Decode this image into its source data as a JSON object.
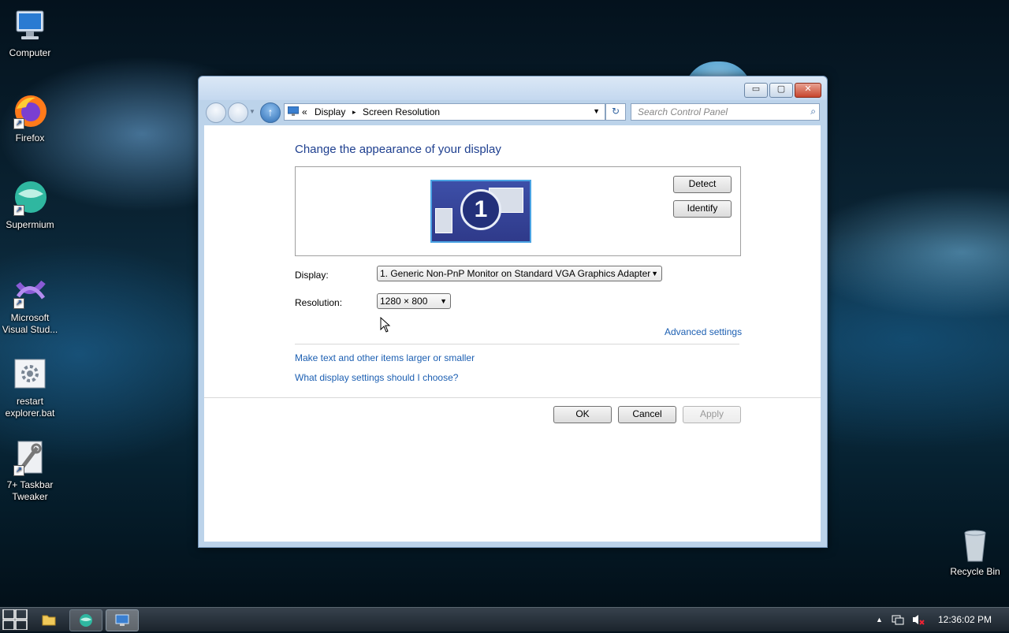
{
  "desktop": {
    "icons": [
      {
        "label": "Computer",
        "icon": "computer-icon"
      },
      {
        "label": "Firefox",
        "icon": "firefox-icon"
      },
      {
        "label": "Supermium",
        "icon": "supermium-icon"
      },
      {
        "label": "Microsoft Visual Stud...",
        "icon": "visual-studio-icon"
      },
      {
        "label": "restart explorer.bat",
        "icon": "batch-file-icon"
      },
      {
        "label": "7+ Taskbar Tweaker",
        "icon": "taskbar-tweaker-icon"
      },
      {
        "label": "Recycle Bin",
        "icon": "recycle-bin-icon"
      }
    ]
  },
  "window": {
    "controls": {
      "minimize": "▭",
      "maximize": "▢",
      "close": "✕"
    },
    "address": {
      "prefix": "«",
      "crumbs": [
        "Display",
        "Screen Resolution"
      ],
      "separator": "▸"
    },
    "search": {
      "placeholder": "Search Control Panel"
    },
    "heading": "Change the appearance of your display",
    "monitor_number": "1",
    "buttons": {
      "detect": "Detect",
      "identify": "Identify",
      "ok": "OK",
      "cancel": "Cancel",
      "apply": "Apply"
    },
    "fields": {
      "display_label": "Display:",
      "display_value": "1. Generic Non-PnP Monitor on Standard VGA Graphics Adapter",
      "resolution_label": "Resolution:",
      "resolution_value": "1280 × 800"
    },
    "links": {
      "advanced": "Advanced settings",
      "text_size": "Make text and other items larger or smaller",
      "which_settings": "What display settings should I choose?"
    }
  },
  "taskbar": {
    "clock": "12:36:02 PM",
    "tray_arrow": "▲"
  }
}
